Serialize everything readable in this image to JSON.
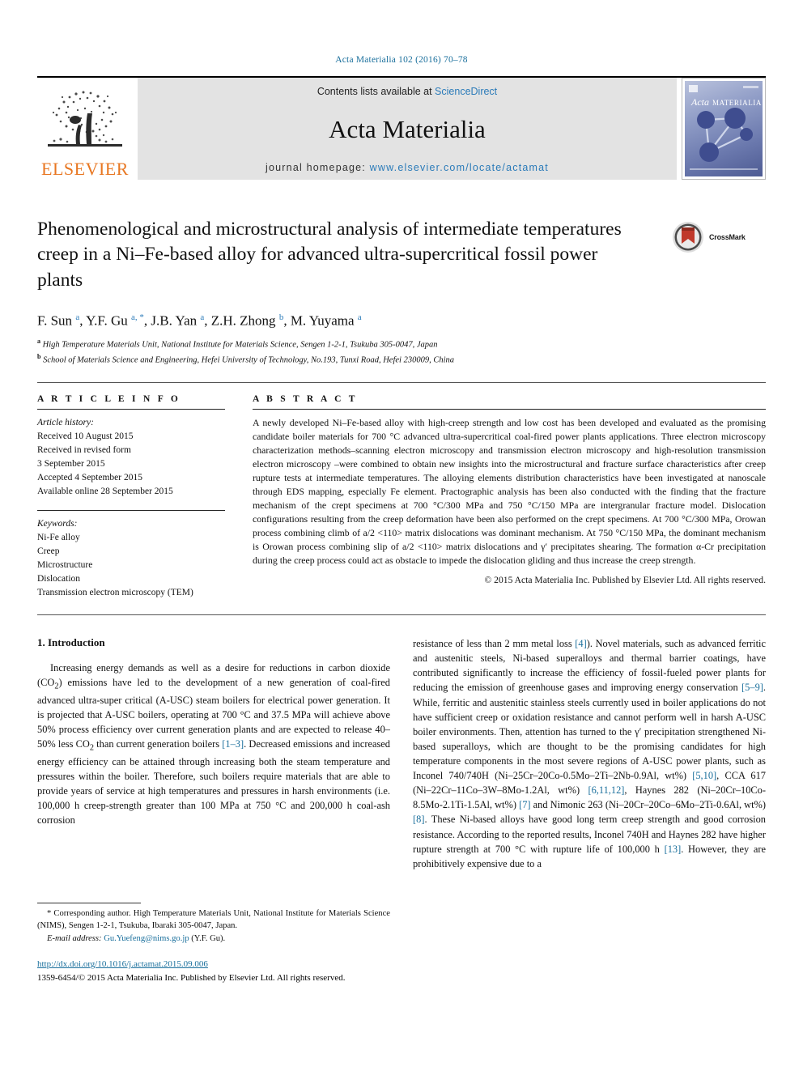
{
  "running_head": "Acta Materialia 102 (2016) 70–78",
  "journal_header": {
    "contents_prefix": "Contents lists available at ",
    "sciencedirect": "ScienceDirect",
    "journal_title": "Acta Materialia",
    "homepage_prefix": "journal homepage: ",
    "homepage_url": "www.elsevier.com/locate/actamat",
    "publisher_logo_word": "ELSEVIER",
    "cover_title_italic": "Acta",
    "cover_title_rest": "MATERIALIA"
  },
  "article": {
    "title": "Phenomenological and microstructural analysis of intermediate temperatures creep in a Ni–Fe-based alloy for advanced ultra-supercritical fossil power plants",
    "crossmark_label": "CrossMark",
    "authors_html": "F. Sun <sup>a</sup>, Y.F. Gu <sup>a, *</sup>, J.B. Yan <sup>a</sup>, Z.H. Zhong <sup>b</sup>, M. Yuyama <sup>a</sup>",
    "affiliations": [
      "High Temperature Materials Unit, National Institute for Materials Science, Sengen 1-2-1, Tsukuba 305-0047, Japan",
      "School of Materials Science and Engineering, Hefei University of Technology, No.193, Tunxi Road, Hefei 230009, China"
    ]
  },
  "article_info": {
    "heading": "A R T I C L E   I N F O",
    "history_label": "Article history:",
    "history": [
      "Received 10 August 2015",
      "Received in revised form",
      "3 September 2015",
      "Accepted 4 September 2015",
      "Available online 28 September 2015"
    ],
    "keywords_label": "Keywords:",
    "keywords": [
      "Ni-Fe alloy",
      "Creep",
      "Microstructure",
      "Dislocation",
      "Transmission electron microscopy (TEM)"
    ]
  },
  "abstract": {
    "heading": "A B S T R A C T",
    "text": "A newly developed Ni–Fe-based alloy with high-creep strength and low cost has been developed and evaluated as the promising candidate boiler materials for 700 °C advanced ultra-supercritical coal-fired power plants applications. Three electron microscopy characterization methods–scanning electron microscopy and transmission electron microscopy and high-resolution transmission electron microscopy –were combined to obtain new insights into the microstructural and fracture surface characteristics after creep rupture tests at intermediate temperatures. The alloying elements distribution characteristics have been investigated at nanoscale through EDS mapping, especially Fe element. Practographic analysis has been also conducted with the finding that the fracture mechanism of the crept specimens at 700 °C/300 MPa and 750 °C/150 MPa are intergranular fracture model. Dislocation configurations resulting from the creep deformation have been also performed on the crept specimens. At 700 °C/300 MPa, Orowan process combining climb of a/2 <110> matrix dislocations was dominant mechanism. At 750 °C/150 MPa, the dominant mechanism is Orowan process combining slip of a/2 <110> matrix dislocations and γ′ precipitates shearing. The formation α-Cr precipitation during the creep process could act as obstacle to impede the dislocation gliding and thus increase the creep strength.",
    "copyright": "© 2015 Acta Materialia Inc. Published by Elsevier Ltd. All rights reserved."
  },
  "introduction": {
    "heading": "1. Introduction",
    "left_paragraph_html": "Increasing energy demands as well as a desire for reductions in carbon dioxide (CO<sub>2</sub>) emissions have led to the development of a new generation of coal-fired advanced ultra-super critical (A-USC) steam boilers for electrical power generation. It is projected that A-USC boilers, operating at 700 °C and 37.5 MPa will achieve above 50% process efficiency over current generation plants and are expected to release 40–50% less CO<sub>2</sub> than current generation boilers <span class=\"ref\">[1–3]</span>. Decreased emissions and increased energy efficiency can be attained through increasing both the steam temperature and pressures within the boiler. Therefore, such boilers require materials that are able to provide years of service at high temperatures and pressures in harsh environments (i.e. 100,000 h creep-strength greater than 100 MPa at 750 °C and 200,000 h coal-ash corrosion",
    "right_paragraph_html": "resistance of less than 2 mm metal loss <span class=\"ref\">[4]</span>). Novel materials, such as advanced ferritic and austenitic steels, Ni-based superalloys and thermal barrier coatings, have contributed significantly to increase the efficiency of fossil-fueled power plants for reducing the emission of greenhouse gases and improving energy conservation <span class=\"ref\">[5–9]</span>. While, ferritic and austenitic stainless steels currently used in boiler applications do not have sufficient creep or oxidation resistance and cannot perform well in harsh A-USC boiler environments. Then, attention has turned to the γ′ precipitation strengthened Ni-based superalloys, which are thought to be the promising candidates for high temperature components in the most severe regions of A-USC power plants, such as Inconel 740/740H (Ni–25Cr–20Co-0.5Mo–2Ti–2Nb-0.9Al, wt%) <span class=\"ref\">[5,10]</span>, CCA 617 (Ni–22Cr–11Co–3W–8Mo-1.2Al, wt%) <span class=\"ref\">[6,11,12]</span>, Haynes 282 (Ni–20Cr–10Co-8.5Mo-2.1Ti-1.5Al, wt%) <span class=\"ref\">[7]</span> and Nimonic 263 (Ni–20Cr–20Co–6Mo–2Ti-0.6Al, wt%) <span class=\"ref\">[8]</span>. These Ni-based alloys have good long term creep strength and good corrosion resistance. According to the reported results, Inconel 740H and Haynes 282 have higher rupture strength at 700 °C with rupture life of 100,000 h <span class=\"ref\">[13]</span>. However, they are prohibitively expensive due to a"
  },
  "footnotes": {
    "corresponding_html": "<span class=\"ind\">* Corresponding author. High Temperature Materials Unit, National Institute for Materials Science (NIMS), Sengen 1-2-1, Tsukuba, Ibaraki 305-0047, Japan.</span>",
    "email_label": "E-mail address:",
    "email": "Gu.Yuefeng@nims.go.jp",
    "email_suffix": "(Y.F. Gu).",
    "doi": "http://dx.doi.org/10.1016/j.actamat.2015.09.006",
    "issn_line": "1359-6454/© 2015 Acta Materialia Inc. Published by Elsevier Ltd. All rights reserved."
  },
  "colors": {
    "link": "#1a6f9c",
    "sciencedirect": "#2b7bb9",
    "elsevier_orange": "#E87722"
  }
}
